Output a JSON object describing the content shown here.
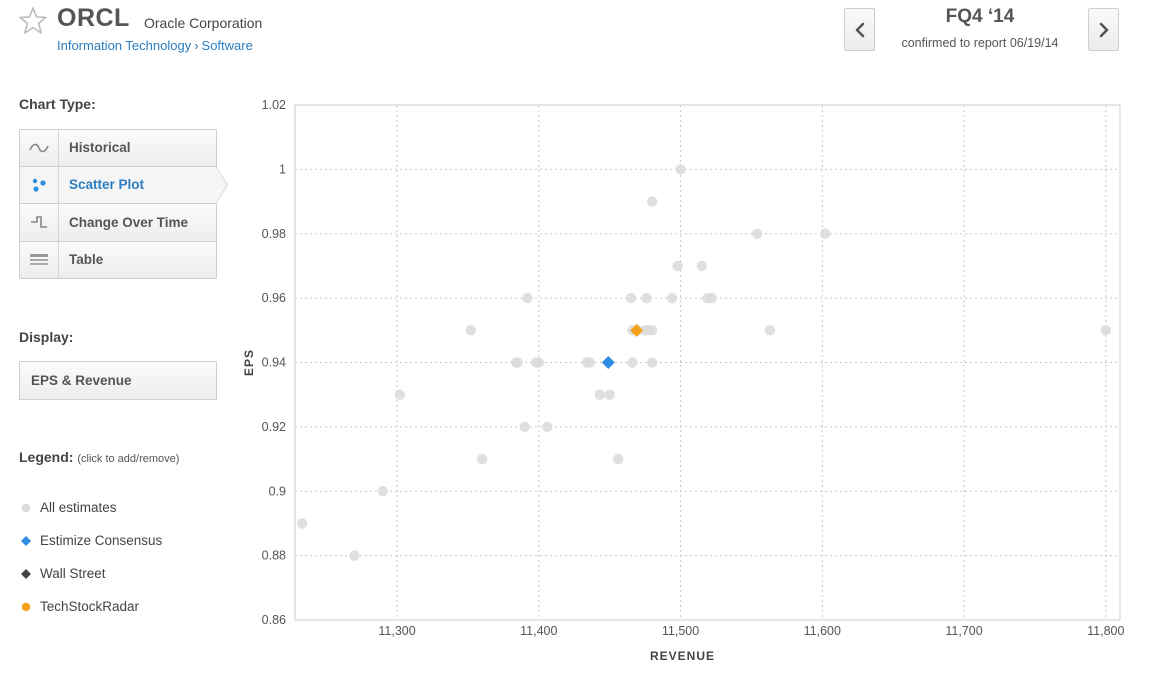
{
  "header": {
    "ticker": "ORCL",
    "company": "Oracle Corporation",
    "breadcrumb": [
      "Information Technology",
      "Software"
    ],
    "breadcrumb_sep": "›",
    "quarter": "FQ4 ‘14",
    "quarter_sub": "confirmed to report 06/19/14",
    "icons": {
      "favorite": "star-icon",
      "prev": "chevron-left-icon",
      "next": "chevron-right-icon"
    }
  },
  "sidebar": {
    "chart_type_label": "Chart Type:",
    "chart_types": [
      {
        "label": "Historical",
        "icon": "wave-icon",
        "active": false
      },
      {
        "label": "Scatter Plot",
        "icon": "scatter-icon",
        "active": true
      },
      {
        "label": "Change Over Time",
        "icon": "step-icon",
        "active": false
      },
      {
        "label": "Table",
        "icon": "table-icon",
        "active": false
      }
    ],
    "display_label": "Display:",
    "display_value": "EPS & Revenue",
    "legend_label": "Legend:",
    "legend_hint": "(click to add/remove)",
    "legend": [
      {
        "label": "All estimates",
        "shape": "circle",
        "color": "#dcdcdc"
      },
      {
        "label": "Estimize Consensus",
        "shape": "diamond",
        "color": "#2f8de4"
      },
      {
        "label": "Wall Street",
        "shape": "diamond",
        "color": "#444444"
      },
      {
        "label": "TechStockRadar",
        "shape": "circle",
        "color": "#f5a11c"
      }
    ]
  },
  "chart_data": {
    "type": "scatter",
    "xlabel": "REVENUE",
    "ylabel": "EPS",
    "xlim": [
      11228,
      11810
    ],
    "ylim": [
      0.86,
      1.02
    ],
    "x_ticks": [
      11300,
      11400,
      11500,
      11600,
      11700,
      11800
    ],
    "x_tick_labels": [
      "11,300",
      "11,400",
      "11,500",
      "11,600",
      "11,700",
      "11,800"
    ],
    "y_ticks": [
      0.86,
      0.88,
      0.9,
      0.92,
      0.94,
      0.96,
      0.98,
      1,
      1.02
    ],
    "y_tick_labels": [
      "0.86",
      "0.88",
      "0.9",
      "0.92",
      "0.94",
      "0.96",
      "0.98",
      "1",
      "1.02"
    ],
    "grid": true,
    "series": [
      {
        "name": "All estimates",
        "marker": "circle",
        "color": "#dcdcdc",
        "points": [
          [
            11233,
            0.89
          ],
          [
            11270,
            0.88
          ],
          [
            11290,
            0.9
          ],
          [
            11302,
            0.93
          ],
          [
            11352,
            0.95
          ],
          [
            11360,
            0.91
          ],
          [
            11384,
            0.94
          ],
          [
            11385,
            0.94
          ],
          [
            11390,
            0.92
          ],
          [
            11392,
            0.96
          ],
          [
            11398,
            0.94
          ],
          [
            11400,
            0.94
          ],
          [
            11406,
            0.92
          ],
          [
            11434,
            0.94
          ],
          [
            11436,
            0.94
          ],
          [
            11443,
            0.93
          ],
          [
            11450,
            0.93
          ],
          [
            11456,
            0.91
          ],
          [
            11465,
            0.96
          ],
          [
            11466,
            0.94
          ],
          [
            11466,
            0.95
          ],
          [
            11470,
            0.95
          ],
          [
            11475,
            0.95
          ],
          [
            11476,
            0.96
          ],
          [
            11477,
            0.95
          ],
          [
            11480,
            0.99
          ],
          [
            11480,
            0.95
          ],
          [
            11480,
            0.94
          ],
          [
            11494,
            0.96
          ],
          [
            11498,
            0.97
          ],
          [
            11500,
            1.0
          ],
          [
            11515,
            0.97
          ],
          [
            11519,
            0.96
          ],
          [
            11522,
            0.96
          ],
          [
            11554,
            0.98
          ],
          [
            11563,
            0.95
          ],
          [
            11602,
            0.98
          ],
          [
            11800,
            0.95
          ]
        ]
      },
      {
        "name": "Estimize Consensus",
        "marker": "diamond",
        "color": "#2f8de4",
        "points": [
          [
            11449,
            0.94
          ]
        ]
      },
      {
        "name": "TechStockRadar",
        "marker": "diamond",
        "color": "#f5a11c",
        "points": [
          [
            11469,
            0.95
          ]
        ]
      }
    ]
  }
}
